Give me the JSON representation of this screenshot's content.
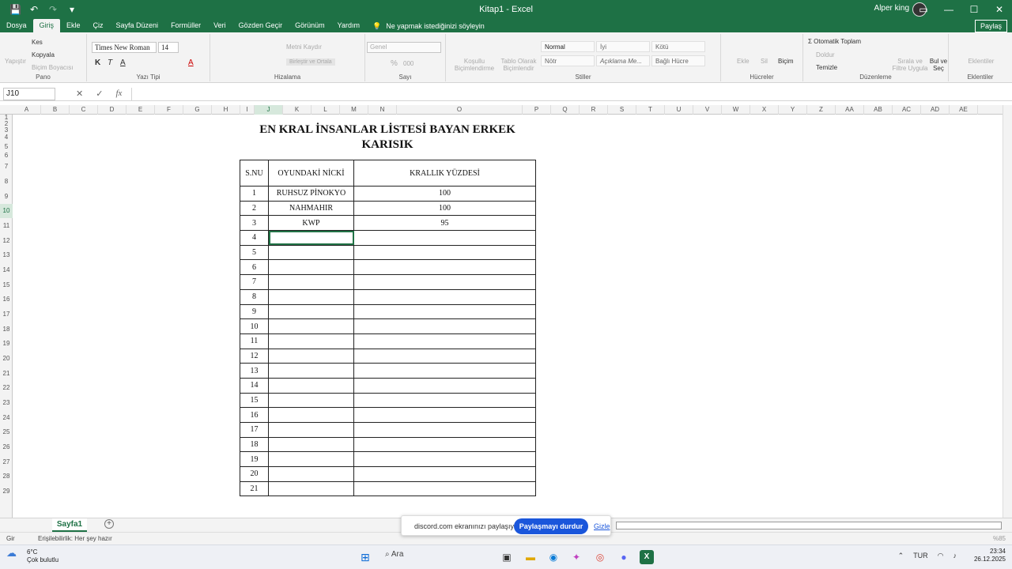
{
  "titlebar": {
    "title": "Kitap1 - Excel",
    "user": "Alper king",
    "minimize": "—",
    "maximize": "☐",
    "close": "✕",
    "save_icon": "💾",
    "undo_icon": "↶",
    "redo_icon": "↷",
    "more_icon": "▾"
  },
  "menu": {
    "tabs": [
      "Dosya",
      "Giriş",
      "Ekle",
      "Çiz",
      "Sayfa Düzeni",
      "Formüller",
      "Veri",
      "Gözden Geçir",
      "Görünüm",
      "Yardım"
    ],
    "tell_me": "Ne yapmak istediğinizi söyleyin",
    "share": "Paylaş"
  },
  "ribbon": {
    "clipboard": {
      "paste": "Yapıştır",
      "cut": "Kes",
      "copy": "Kopyala",
      "format_painter": "Biçim Boyacısı",
      "label": "Pano"
    },
    "font": {
      "name": "Times New Roman",
      "size": "14",
      "bold": "K",
      "italic": "T",
      "underline": "A",
      "label": "Yazı Tipi"
    },
    "alignment": {
      "wrap": "Metni Kaydır",
      "merge": "Birleştir ve Ortala",
      "label": "Hizalama"
    },
    "number": {
      "format": "Genel",
      "percent": "%",
      "comma": "000",
      "label": "Sayı"
    },
    "styles": {
      "conditional": "Koşullu Biçimlendirme",
      "as_table": "Tablo Olarak Biçimlendir",
      "cells": [
        "Normal",
        "İyi",
        "Kötü",
        "Nötr",
        "Açıklama Me...",
        "Bağlı Hücre"
      ],
      "label": "Stiller"
    },
    "cells_group": {
      "insert": "Ekle",
      "delete": "Sil",
      "format": "Biçim",
      "label": "Hücreler"
    },
    "editing": {
      "autosum": "Otomatik Toplam",
      "fill": "Doldur",
      "clear": "Temizle",
      "sort": "Sırala ve Filtre Uygula",
      "find": "Bul ve Seç",
      "label": "Düzenleme"
    },
    "addins": {
      "label": "Eklentiler",
      "item": "Eklentiler"
    }
  },
  "formula_bar": {
    "name_box": "J10",
    "cancel": "✕",
    "enter": "✓",
    "fx": "fx",
    "value": ""
  },
  "columns": [
    "A",
    "B",
    "C",
    "D",
    "E",
    "F",
    "G",
    "H",
    "I",
    "J",
    "K",
    "L",
    "M",
    "N",
    "O",
    "P",
    "Q",
    "R",
    "S",
    "T",
    "U",
    "V",
    "W",
    "X",
    "Y",
    "Z",
    "AA",
    "AB",
    "AC",
    "AD",
    "AE"
  ],
  "rows": [
    "1",
    "2",
    "3",
    "4",
    "5",
    "6",
    "7",
    "8",
    "9",
    "10",
    "11",
    "12",
    "13",
    "14",
    "15",
    "16",
    "17",
    "18",
    "19",
    "20",
    "21",
    "22",
    "23",
    "24",
    "25",
    "26",
    "27",
    "28",
    "29"
  ],
  "sheet": {
    "title": "EN KRAL İNSANLAR LİSTESİ BAYAN ERKEK KARISIK",
    "headers": [
      "S.NU",
      "OYUNDAKİ NİCKİ",
      "KRALLIK YÜZDESİ"
    ],
    "rows": [
      [
        "1",
        "RUHSUZ PİNOKYO",
        "100"
      ],
      [
        "2",
        "NAHMAHIR",
        "100"
      ],
      [
        "3",
        "KWP",
        "95"
      ],
      [
        "4",
        "",
        ""
      ],
      [
        "5",
        "",
        ""
      ],
      [
        "6",
        "",
        ""
      ],
      [
        "7",
        "",
        ""
      ],
      [
        "8",
        "",
        ""
      ],
      [
        "9",
        "",
        ""
      ],
      [
        "10",
        "",
        ""
      ],
      [
        "11",
        "",
        ""
      ],
      [
        "12",
        "",
        ""
      ],
      [
        "13",
        "",
        ""
      ],
      [
        "14",
        "",
        ""
      ],
      [
        "15",
        "",
        ""
      ],
      [
        "16",
        "",
        ""
      ],
      [
        "17",
        "",
        ""
      ],
      [
        "18",
        "",
        ""
      ],
      [
        "19",
        "",
        ""
      ],
      [
        "20",
        "",
        ""
      ],
      [
        "21",
        "",
        ""
      ]
    ]
  },
  "sheetbar": {
    "tab": "Sayfa1",
    "add": "+"
  },
  "statusbar": {
    "mode": "Gir",
    "accessibility": "Erişilebilirlik: Her şey hazır",
    "zoom": "%85"
  },
  "discord": {
    "message": "discord.com ekranınızı paylaşıyor.",
    "stop": "Paylaşmayı durdur",
    "hide": "Gizle"
  },
  "taskbar": {
    "temp": "6°C",
    "weather": "Çok bulutlu",
    "search": "Ara",
    "lang": "TUR",
    "time": "23:34",
    "date": "26.12.2025"
  },
  "colors": {
    "excel_green": "#1e7145",
    "selection": "#217346",
    "discord_blue": "#1a56db"
  }
}
